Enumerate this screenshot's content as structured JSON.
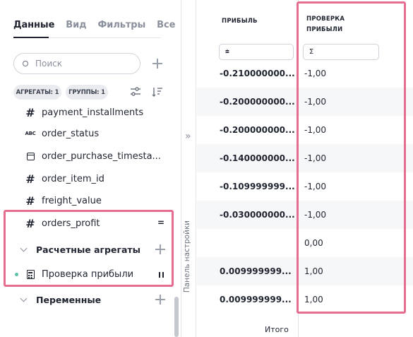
{
  "tabs": [
    {
      "label": "Данные",
      "active": true
    },
    {
      "label": "Вид",
      "active": false
    },
    {
      "label": "Фильтры",
      "active": false
    },
    {
      "label": "Все",
      "active": false
    }
  ],
  "search": {
    "placeholder": "Поиск"
  },
  "chips": {
    "aggregates": "АГРЕГАТЫ: 1",
    "groups": "ГРУППЫ: 1"
  },
  "fields": [
    {
      "icon": "number-icon",
      "name": "payment_installments"
    },
    {
      "icon": "text-type-icon",
      "name": "order_status",
      "type_label": "ABC"
    },
    {
      "icon": "calendar-icon",
      "name": "order_purchase_timesta..."
    },
    {
      "icon": "number-icon",
      "name": "order_item_id"
    },
    {
      "icon": "number-icon",
      "name": "freight_value"
    },
    {
      "icon": "number-icon",
      "name": "orders_profit",
      "mark": "="
    }
  ],
  "groups": {
    "calculated": "Расчетные агрегаты",
    "variables": "Переменные"
  },
  "calc_item": {
    "name": "Проверка прибыли"
  },
  "side_panel": {
    "label": "Панель настройки",
    "collapse_glyph": "»"
  },
  "table": {
    "columns": [
      {
        "title": "ПРИБЫЛЬ",
        "filter_glyph": "⩧"
      },
      {
        "title": "ПРОВЕРКА ПРИБЫЛИ",
        "filter_glyph": "Σ"
      }
    ],
    "rows": [
      {
        "profit": "-0.210000000...",
        "check": "-1,00"
      },
      {
        "profit": "-0.200000000...",
        "check": "-1,00"
      },
      {
        "profit": "-0.200000000...",
        "check": "-1,00"
      },
      {
        "profit": "-0.140000000...",
        "check": "-1,00"
      },
      {
        "profit": "-0.109999999...",
        "check": "-1,00"
      },
      {
        "profit": "-0.030000000...",
        "check": "-1,00"
      },
      {
        "profit": "",
        "check": "0,00"
      },
      {
        "profit": "0.009999999...",
        "check": "1,00"
      },
      {
        "profit": "0.009999999...",
        "check": "1,00"
      }
    ],
    "total_label": "Итого"
  },
  "colors": {
    "highlight": "#e56d8f",
    "accent": "#5bc0a8"
  }
}
